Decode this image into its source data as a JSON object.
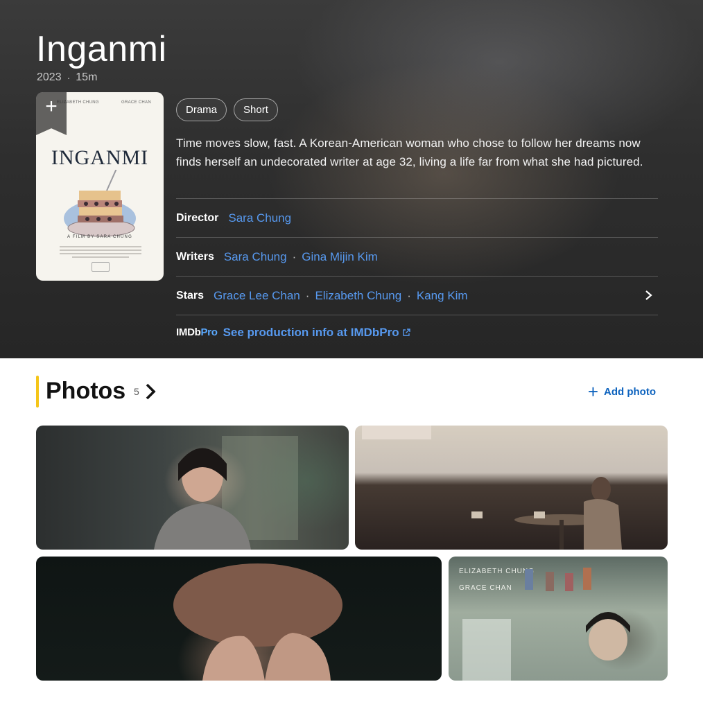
{
  "movie": {
    "title": "Inganmi",
    "year": "2023",
    "separator": "·",
    "runtime": "15m",
    "genres": [
      "Drama",
      "Short"
    ],
    "plot": "Time moves slow, fast. A Korean-American woman who chose to follow her dreams now finds herself an undecorated writer at age 32, living a life far from what she had pictured."
  },
  "poster": {
    "credit_left": "ELIZABETH CHUNG",
    "credit_right": "GRACE CHAN",
    "title": "INGANMI",
    "byline": "A FILM BY SARA CHUNG",
    "watchlist_icon": "plus-icon"
  },
  "credits": {
    "director_label": "Director",
    "director": "Sara Chung",
    "writers_label": "Writers",
    "writers": [
      "Sara Chung",
      "Gina Mijin Kim"
    ],
    "stars_label": "Stars",
    "stars": [
      "Grace Lee Chan",
      "Elizabeth Chung",
      "Kang Kim"
    ],
    "dot": "·"
  },
  "imdbpro": {
    "logo_imdb": "IMDb",
    "logo_pro": "Pro",
    "link": "See production info at IMDbPro"
  },
  "photos": {
    "heading": "Photos",
    "count": "5",
    "add_label": "Add photo",
    "caption_line1": "ELIZABETH CHUNG",
    "caption_line2": "GRACE CHAN"
  },
  "colors": {
    "accent": "#f5c518",
    "link": "#5799ef",
    "add_link": "#0e63be"
  }
}
